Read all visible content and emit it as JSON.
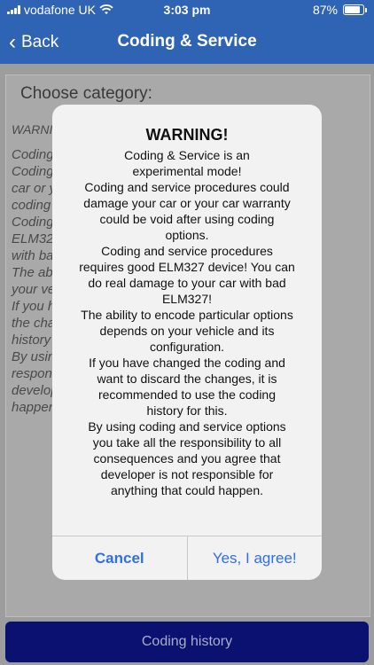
{
  "status": {
    "carrier": "vodafone UK",
    "time": "3:03 pm",
    "battery": "87%"
  },
  "nav": {
    "back_label": "Back",
    "title": "Coding & Service"
  },
  "content": {
    "choose_label": "Choose category:",
    "bg_warning": "WARNI",
    "bg_lines": [
      "Coding",
      "Coding                                                     ur",
      "car or y",
      "coding",
      "Coding",
      "ELM327                                                    car",
      "with bad",
      "The abi                                                     on",
      "your ve",
      "If you h                                                   ard",
      "the cha                                                       g",
      "history",
      "By usin                                                      he",
      "respons                                                   that",
      "develop                                                     ld",
      "happen"
    ],
    "history_button": "Coding history"
  },
  "dialog": {
    "title": "WARNING!",
    "message_lines": [
      "Coding & Service is an",
      "experimental mode!",
      "Coding and service procedures could",
      "damage your car or your car warranty",
      "could be void after using coding",
      "options.",
      "Coding and service procedures",
      "requires good ELM327 device! You can",
      "do real damage to your car with bad",
      "ELM327!",
      "The ability to encode particular options",
      "depends on your vehicle and its",
      "configuration.",
      "If you have changed the coding and",
      "want to discard the changes, it is",
      "recommended to use the coding",
      "history for this.",
      "By using coding and service options",
      "you take all the responsibility to all",
      "consequences and you agree that",
      "developer is not responsible for",
      "anything that could happen."
    ],
    "cancel_label": "Cancel",
    "agree_label": "Yes, I agree!"
  }
}
